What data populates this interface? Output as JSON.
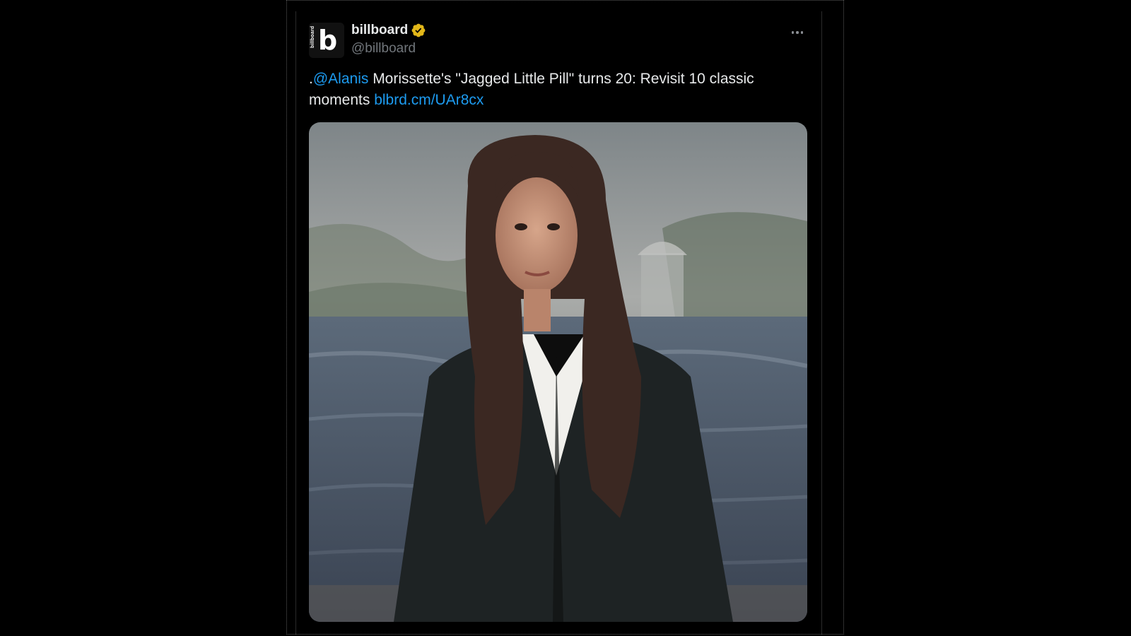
{
  "tweet": {
    "author_name": "billboard",
    "author_handle": "@billboard",
    "avatar_letter": "b",
    "avatar_wordmark": "billboard",
    "text_prefix": ".",
    "mention": "@Alanis",
    "text_body": " Morissette's \"Jagged Little Pill\" turns 20: Revisit 10 classic moments ",
    "link": "blbrd.cm/UAr8cx",
    "media_alt": "Photo of Alanis Morissette",
    "verified_icon": "verified-badge-icon",
    "more_icon": "more-horizontal-icon"
  },
  "colors": {
    "background": "#000000",
    "link": "#1d9bf0",
    "text": "#e7e9ea",
    "muted": "#71767b",
    "verified": "#e2b719"
  }
}
